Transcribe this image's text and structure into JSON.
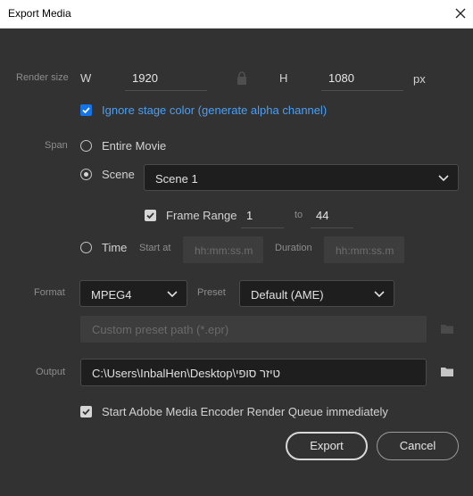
{
  "window": {
    "title": "Export Media"
  },
  "render_size": {
    "label": "Render size",
    "w_label": "W",
    "width": "1920",
    "h_label": "H",
    "height": "1080",
    "unit": "px"
  },
  "ignore_stage": {
    "label": "Ignore stage color (generate alpha channel)",
    "checked": true
  },
  "span": {
    "label": "Span",
    "entire_movie": "Entire Movie",
    "scene": "Scene",
    "scene_value": "Scene 1",
    "frame_range": {
      "label": "Frame Range",
      "from": "1",
      "to_label": "to",
      "to": "44",
      "checked": true
    },
    "time": "Time",
    "start_at": "Start at",
    "start_placeholder": "hh:mm:ss.m",
    "duration": "Duration",
    "duration_placeholder": "hh:mm:ss.m",
    "selected": "Scene"
  },
  "format": {
    "label": "Format",
    "value": "MPEG4",
    "preset_label": "Preset",
    "preset_value": "Default (AME)",
    "custom_placeholder": "Custom preset path (*.epr)"
  },
  "output": {
    "label": "Output",
    "path": "C:\\Users\\InbalHen\\Desktop\\טיזר סופי"
  },
  "start_ame": {
    "label": "Start Adobe Media Encoder Render Queue immediately",
    "checked": true
  },
  "buttons": {
    "export": "Export",
    "cancel": "Cancel"
  },
  "colors": {
    "accent": "#1473e6",
    "background": "#323232",
    "link_text": "#4a9ff5"
  }
}
